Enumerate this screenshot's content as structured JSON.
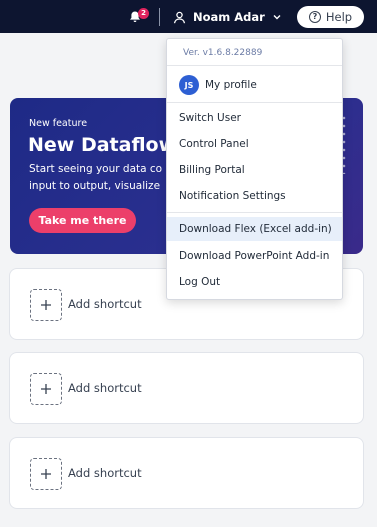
{
  "header": {
    "notifications_count": "2",
    "user_name": "Noam Adar",
    "help_label": "Help",
    "help_symbol": "?"
  },
  "banner": {
    "tag": "New feature",
    "headline": "New Dataflow",
    "body_line1": "Start seeing your data co",
    "body_line2": "input to output, visualize",
    "cta": "Take me there"
  },
  "shortcuts": [
    {
      "label": "Add shortcut"
    },
    {
      "label": "Add shortcut"
    },
    {
      "label": "Add shortcut"
    }
  ],
  "menu": {
    "version": "Ver. v1.6.8.22889",
    "profile_initials": "JS",
    "profile_label": "My profile",
    "items": [
      {
        "label": "Switch User"
      },
      {
        "label": "Control Panel"
      },
      {
        "label": "Billing Portal"
      },
      {
        "label": "Notification Settings"
      },
      {
        "label": "Download Flex (Excel add-in)"
      },
      {
        "label": "Download PowerPoint Add-in"
      },
      {
        "label": "Log Out"
      }
    ]
  },
  "colors": {
    "topbar": "#0d1530",
    "banner": "#1e2a86",
    "cta": "#ec3f6a",
    "avatar": "#2d5fd3",
    "badge": "#e0245e"
  }
}
